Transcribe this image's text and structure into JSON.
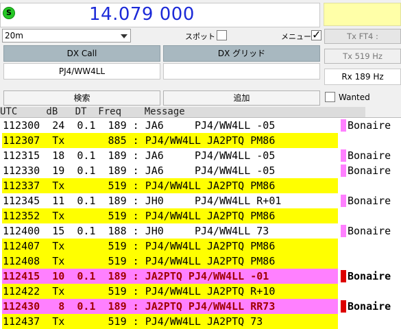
{
  "status_icon": "S",
  "frequency": "14.079 000",
  "band": {
    "selected": "20m"
  },
  "spot_label": "スポット",
  "menu_label": "メニュー",
  "spot_checked": false,
  "menu_checked": true,
  "tx_mode": "Tx FT4 :",
  "tx_freq": "Tx  519  Hz",
  "rx_freq": "Rx  189  Hz",
  "dx_call_label": "DX Call",
  "dx_grid_label": "DX グリッド",
  "dx_call_value": "PJ4/WW4LL",
  "dx_grid_value": "",
  "search_button": "検索",
  "add_button": "追加",
  "wanted_label": "Wanted",
  "wanted_checked": false,
  "grid_header": "UTC     dB   DT  Freq    Message",
  "rows": [
    {
      "text": "112300  24  0.1  189 : JA6     PJ4/WW4LL -05",
      "type": "rx",
      "country": "Bonaire",
      "marker": "#ff80ff"
    },
    {
      "text": "112307  Tx       885 : PJ4/WW4LL JA2PTQ PM86",
      "type": "tx",
      "country": "",
      "marker": ""
    },
    {
      "text": "112315  18  0.1  189 : JA6     PJ4/WW4LL -05",
      "type": "rx",
      "country": "Bonaire",
      "marker": "#ff80ff"
    },
    {
      "text": "112330  19  0.1  189 : JA6     PJ4/WW4LL -05",
      "type": "rx",
      "country": "Bonaire",
      "marker": "#ff80ff"
    },
    {
      "text": "112337  Tx       519 : PJ4/WW4LL JA2PTQ PM86",
      "type": "tx",
      "country": "",
      "marker": ""
    },
    {
      "text": "112345  11  0.1  189 : JH0     PJ4/WW4LL R+01",
      "type": "rx",
      "country": "Bonaire",
      "marker": "#ff80ff"
    },
    {
      "text": "112352  Tx       519 : PJ4/WW4LL JA2PTQ PM86",
      "type": "tx",
      "country": "",
      "marker": ""
    },
    {
      "text": "112400  15  0.1  188 : JH0     PJ4/WW4LL 73",
      "type": "rx",
      "country": "Bonaire",
      "marker": "#ff80ff"
    },
    {
      "text": "112407  Tx       519 : PJ4/WW4LL JA2PTQ PM86",
      "type": "tx",
      "country": "",
      "marker": ""
    },
    {
      "text": "112408  Tx       519 : PJ4/WW4LL JA2PTQ PM86",
      "type": "tx",
      "country": "",
      "marker": ""
    },
    {
      "text": "112415  10  0.1  189 : JA2PTQ PJ4/WW4LL -01",
      "type": "hl",
      "country": "Bonaire",
      "marker": "#dd0000"
    },
    {
      "text": "112422  Tx       519 : PJ4/WW4LL JA2PTQ R+10",
      "type": "tx",
      "country": "",
      "marker": ""
    },
    {
      "text": "112430   8  0.1  189 : JA2PTQ PJ4/WW4LL RR73",
      "type": "hl",
      "country": "Bonaire",
      "marker": "#dd0000"
    },
    {
      "text": "112437  Tx       519 : PJ4/WW4LL JA2PTQ 73",
      "type": "tx",
      "country": "",
      "marker": ""
    }
  ]
}
